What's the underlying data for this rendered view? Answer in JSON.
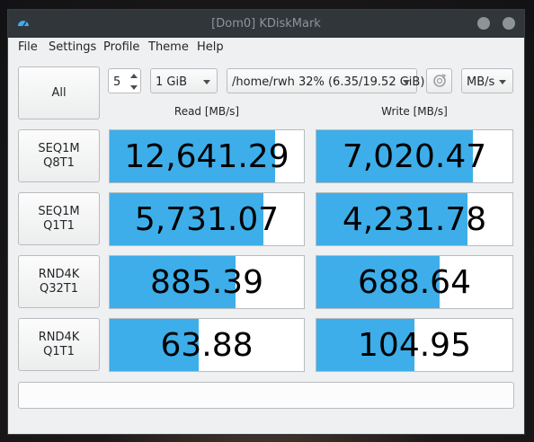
{
  "window": {
    "title": "[Dom0] KDiskMark"
  },
  "menu": [
    "File",
    "Settings",
    "Profile",
    "Theme",
    "Help"
  ],
  "toolbar": {
    "all_label": "All",
    "runs": "5",
    "size": "1 GiB",
    "path": "/home/rwh 32% (6.35/19.52 GiB)",
    "units": "MB/s",
    "refresh_icon": "refresh-icon"
  },
  "headers": {
    "read": "Read [MB/s]",
    "write": "Write [MB/s]"
  },
  "tests": [
    {
      "label_line1": "SEQ1M",
      "label_line2": "Q8T1",
      "read": "12,641.29",
      "read_fill": 0.85,
      "write": "7,020.47",
      "write_fill": 0.8
    },
    {
      "label_line1": "SEQ1M",
      "label_line2": "Q1T1",
      "read": "5,731.07",
      "read_fill": 0.79,
      "write": "4,231.78",
      "write_fill": 0.77
    },
    {
      "label_line1": "RND4K",
      "label_line2": "Q32T1",
      "read": "885.39",
      "read_fill": 0.65,
      "write": "688.64",
      "write_fill": 0.63
    },
    {
      "label_line1": "RND4K",
      "label_line2": "Q1T1",
      "read": "63.88",
      "read_fill": 0.46,
      "write": "104.95",
      "write_fill": 0.5
    }
  ],
  "status_text": "",
  "colors": {
    "accent": "#3daee9",
    "titlebar": "#31363b"
  }
}
